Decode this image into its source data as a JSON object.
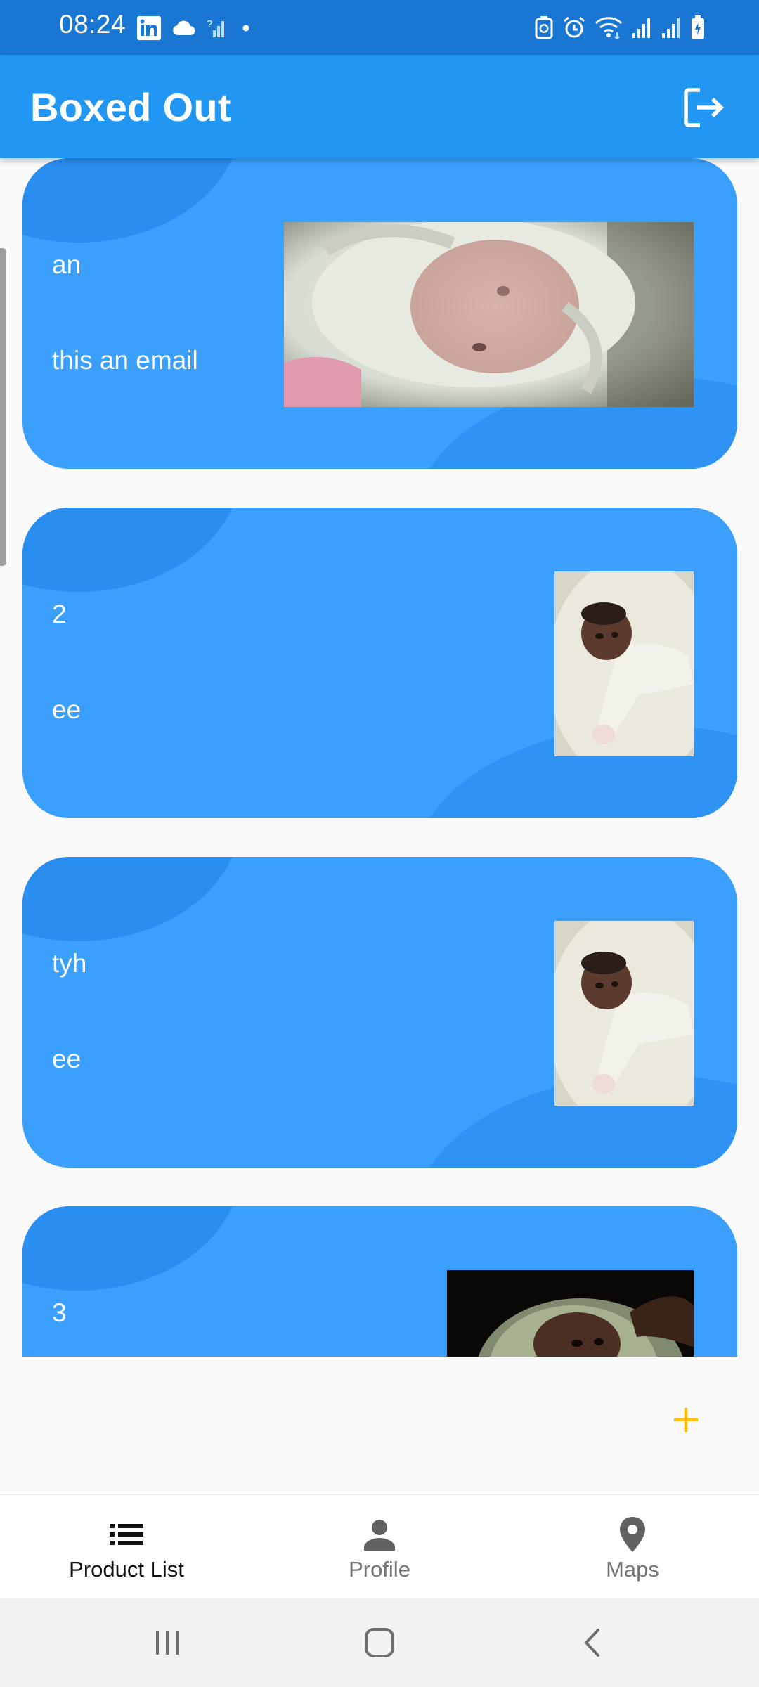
{
  "status_bar": {
    "time": "08:24",
    "left_icons": [
      "linkedin-icon",
      "cloud-icon",
      "signal-unknown-icon",
      "dot-icon"
    ],
    "right_icons": [
      "battery-saver-icon",
      "alarm-icon",
      "wifi-icon",
      "signal-icon",
      "signal-icon",
      "battery-charging-icon"
    ]
  },
  "app_bar": {
    "title": "Boxed Out",
    "action_icon": "logout-icon"
  },
  "products": [
    {
      "title": "an",
      "subtitle": "this an email",
      "image": "baby-blanket-photo"
    },
    {
      "title": "2",
      "subtitle": "ee",
      "image": "baby-lying-photo"
    },
    {
      "title": "tyh",
      "subtitle": "ee",
      "image": "baby-lying-photo"
    },
    {
      "title": "3",
      "subtitle": "",
      "image": "baby-dark-photo"
    }
  ],
  "fab": {
    "icon": "plus-icon"
  },
  "bottom_nav": {
    "items": [
      {
        "label": "Product List",
        "icon": "list-icon",
        "active": true
      },
      {
        "label": "Profile",
        "icon": "person-icon",
        "active": false
      },
      {
        "label": "Maps",
        "icon": "location-pin-icon",
        "active": false
      }
    ]
  },
  "system_nav": {
    "buttons": [
      "recents-icon",
      "home-icon",
      "back-icon"
    ]
  },
  "colors": {
    "status_bar": "#1976d2",
    "app_bar": "#2196f3",
    "card": "#3a9ffd",
    "fab_accent": "#ffc107"
  }
}
